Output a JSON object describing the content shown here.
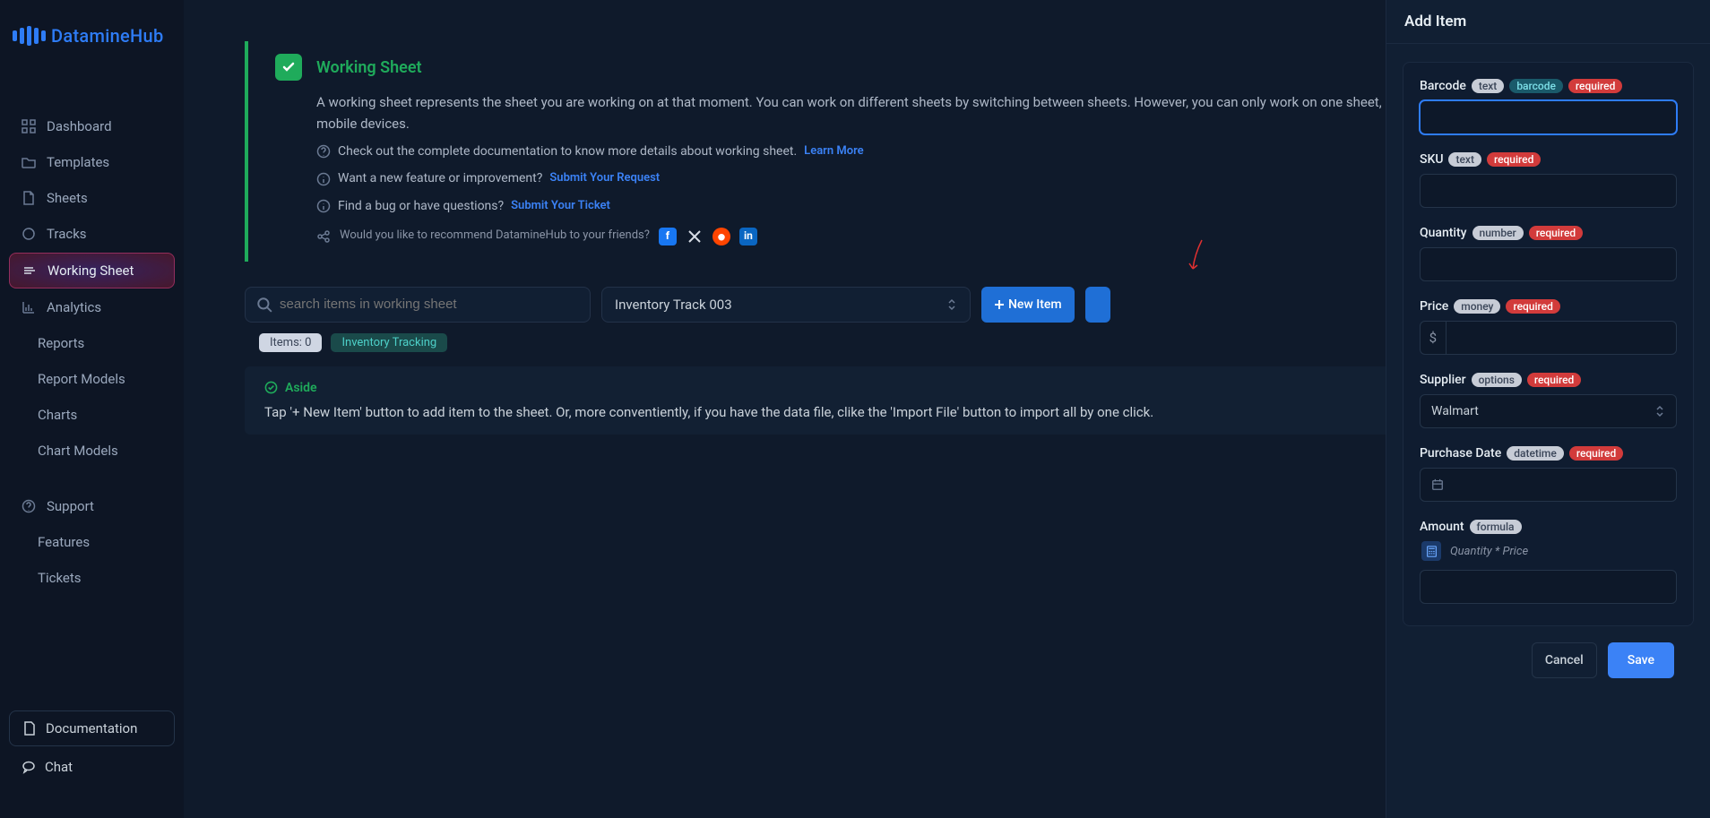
{
  "logo": {
    "text": "DatamineHub"
  },
  "sidebar": {
    "items": [
      {
        "label": "Dashboard"
      },
      {
        "label": "Templates"
      },
      {
        "label": "Sheets"
      },
      {
        "label": "Tracks"
      },
      {
        "label": "Working Sheet"
      },
      {
        "label": "Analytics"
      },
      {
        "label": "Reports"
      },
      {
        "label": "Report Models"
      },
      {
        "label": "Charts"
      },
      {
        "label": "Chart Models"
      },
      {
        "label": "Support"
      },
      {
        "label": "Features"
      },
      {
        "label": "Tickets"
      }
    ],
    "documentation": "Documentation",
    "chat": "Chat"
  },
  "info": {
    "title": "Working Sheet",
    "desc": "A working sheet represents the sheet you are working on at that moment. You can work on different sheets by switching between sheets. However, you can only work on one sheet, even across different mobile devices.",
    "doc_line": "Check out the complete documentation to know more details about working sheet.",
    "learn_more": "Learn More",
    "feature_line": "Want a new feature or improvement?",
    "submit_request": "Submit Your Request",
    "bug_line": "Find a bug or have questions?",
    "submit_ticket": "Submit Your Ticket",
    "share_line": "Would you like to recommend DatamineHub to your friends?"
  },
  "toolbar": {
    "search_placeholder": "search items in working sheet",
    "track_selected": "Inventory Track 003",
    "new_item": "New Item"
  },
  "chips": {
    "items": "Items: 0",
    "category": "Inventory Tracking"
  },
  "aside": {
    "title": "Aside",
    "text": "Tap '+ New Item' button to add item to the sheet. Or, more conventiently, if you have the data file, clike the 'Import File' button to import all by one click."
  },
  "drawer": {
    "title": "Add Item",
    "fields": {
      "barcode": {
        "label": "Barcode",
        "type": "text",
        "extra": "barcode",
        "required": "required"
      },
      "sku": {
        "label": "SKU",
        "type": "text",
        "required": "required"
      },
      "quantity": {
        "label": "Quantity",
        "type": "number",
        "required": "required"
      },
      "price": {
        "label": "Price",
        "type": "money",
        "required": "required",
        "prefix": "$"
      },
      "supplier": {
        "label": "Supplier",
        "type": "options",
        "required": "required",
        "value": "Walmart"
      },
      "purchase_date": {
        "label": "Purchase Date",
        "type": "datetime",
        "required": "required"
      },
      "amount": {
        "label": "Amount",
        "type": "formula",
        "formula": "Quantity * Price"
      }
    },
    "cancel": "Cancel",
    "save": "Save"
  }
}
